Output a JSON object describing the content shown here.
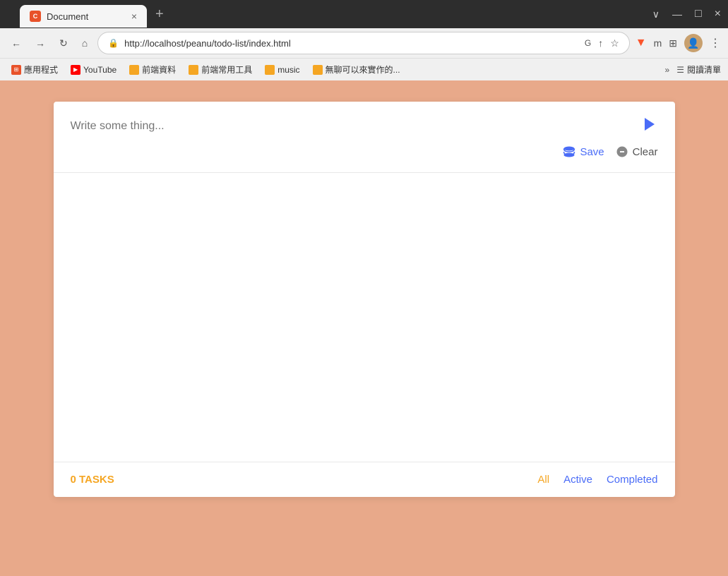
{
  "browser": {
    "title": "Document",
    "url": "http://localhost/peanu/todo-list/index.html",
    "tab_label": "Document",
    "tab_close": "×",
    "tab_new": "+",
    "window_controls": {
      "minimize": "—",
      "maximize": "□",
      "close": "×",
      "restore": "∨"
    }
  },
  "nav": {
    "back": "←",
    "forward": "→",
    "refresh": "↻",
    "home": "⌂",
    "lock_icon": "🔒",
    "translate_icon": "T",
    "share_icon": "↑",
    "star_icon": "☆",
    "v_icon": "▼",
    "m_icon": "m",
    "puzzle_icon": "⊞",
    "menu_icon": "⋮"
  },
  "bookmarks": [
    {
      "label": "應用程式",
      "color": "#e8522a"
    },
    {
      "label": "YouTube",
      "color": "#ff0000"
    },
    {
      "label": "前端資料",
      "color": "#f5a623"
    },
    {
      "label": "前端常用工具",
      "color": "#f5a623"
    },
    {
      "label": "music",
      "color": "#f5a623"
    },
    {
      "label": "無聊可以來實作的...",
      "color": "#f5a623"
    }
  ],
  "bookmark_more": "»",
  "reader_btn": "閱讀清單",
  "todo": {
    "input_placeholder": "Write some thing...",
    "tasks_count": "0 TASKS",
    "save_label": "Save",
    "clear_label": "Clear",
    "filters": {
      "all": "All",
      "active": "Active",
      "completed": "Completed"
    },
    "items": []
  }
}
